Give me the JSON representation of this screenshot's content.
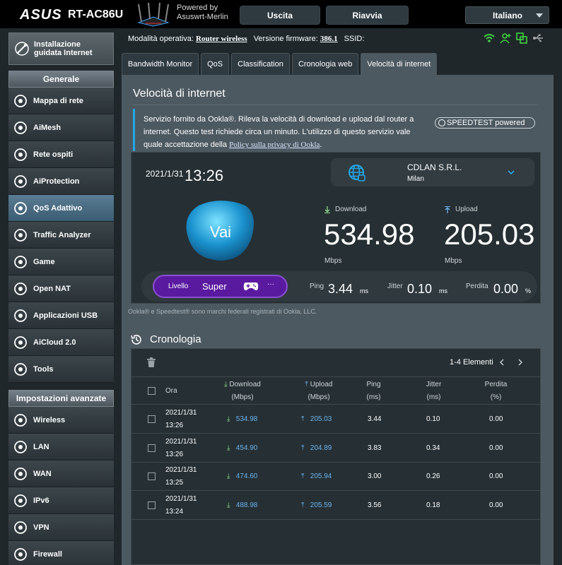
{
  "header": {
    "brand": "ASUS",
    "model": "RT-AC86U",
    "powered_line1": "Powered by",
    "powered_line2": "Asuswrt-Merlin",
    "logout_label": "Uscita",
    "reboot_label": "Riavvia",
    "language": "Italiano"
  },
  "sidebar": {
    "wizard_line1": "Installazione",
    "wizard_line2": "guidata Internet",
    "general_title": "Generale",
    "general_items": [
      {
        "label": "Mappa di rete",
        "icon": "globe-network-icon"
      },
      {
        "label": "AiMesh",
        "icon": "aimesh-icon"
      },
      {
        "label": "Rete ospiti",
        "icon": "guest-network-icon"
      },
      {
        "label": "AiProtection",
        "icon": "shield-lock-icon"
      },
      {
        "label": "QoS Adattivo",
        "icon": "speedometer-icon"
      },
      {
        "label": "Traffic Analyzer",
        "icon": "traffic-icon"
      },
      {
        "label": "Game",
        "icon": "gamepad-icon"
      },
      {
        "label": "Open NAT",
        "icon": "open-nat-icon"
      },
      {
        "label": "Applicazioni USB",
        "icon": "usb-apps-icon"
      },
      {
        "label": "AiCloud 2.0",
        "icon": "cloud-icon"
      },
      {
        "label": "Tools",
        "icon": "wrench-icon"
      }
    ],
    "advanced_title": "Impostazioni avanzate",
    "advanced_items": [
      {
        "label": "Wireless",
        "icon": "wireless-icon"
      },
      {
        "label": "LAN",
        "icon": "lan-icon"
      },
      {
        "label": "WAN",
        "icon": "wan-icon"
      },
      {
        "label": "IPv6",
        "icon": "ipv6-icon"
      },
      {
        "label": "VPN",
        "icon": "vpn-icon"
      },
      {
        "label": "Firewall",
        "icon": "firewall-icon"
      }
    ]
  },
  "status": {
    "mode_label": "Modalità operativa:",
    "mode_value": "Router wireless",
    "firmware_label": "Versione firmware:",
    "firmware_value": "386.1",
    "ssid_label": "SSID:"
  },
  "tabs": [
    {
      "label": "Bandwidth Monitor",
      "active": false
    },
    {
      "label": "QoS",
      "active": false
    },
    {
      "label": "Classification",
      "active": false
    },
    {
      "label": "Cronologia web",
      "active": false
    },
    {
      "label": "Velocità di internet",
      "active": true
    }
  ],
  "speedtest": {
    "title": "Velocità di internet",
    "info_text": "Servizio fornito da Ookla®. Rileva la velocità di download e upload dal router a internet. Questo test richiede circa un minuto. L'utilizzo di questo servizio vale quale accettazione della ",
    "policy_link": "Policy sulla privacy di Ookla",
    "info_end": ".",
    "badge": "SPEEDTEST powered",
    "date": "2021/1/31",
    "time": "13:26",
    "server_name": "CDLAN S.R.L.",
    "server_city": "Milan",
    "go_label": "Vai",
    "download_label": "Download",
    "download_value": "534.98",
    "download_unit": "Mbps",
    "upload_label": "Upload",
    "upload_value": "205.03",
    "upload_unit": "Mbps",
    "level_label": "Livello",
    "level_value": "Super",
    "level_more": "···",
    "ping_label": "Ping",
    "ping_value": "3.44",
    "ping_unit": "ms",
    "jitter_label": "Jitter",
    "jitter_value": "0.10",
    "jitter_unit": "ms",
    "loss_label": "Perdita",
    "loss_value": "0.00",
    "loss_unit": "%",
    "trademark": "Ookla® e Speedtest® sono marchi federali registrati di Ookla, LLC."
  },
  "history": {
    "title": "Cronologia",
    "counter": "1-4 Elementi",
    "headers": {
      "time": "Ora",
      "download": "Download",
      "download_unit": "(Mbps)",
      "upload": "Upload",
      "upload_unit": "(Mbps)",
      "ping": "Ping",
      "ping_unit": "(ms)",
      "jitter": "Jitter",
      "jitter_unit": "(ms)",
      "loss": "Perdita",
      "loss_unit": "(%)"
    },
    "rows": [
      {
        "date": "2021/1/31",
        "time": "13:26",
        "download": "534.98",
        "upload": "205.03",
        "ping": "3.44",
        "jitter": "0.10",
        "loss": "0.00"
      },
      {
        "date": "2021/1/31",
        "time": "13:26",
        "download": "454.90",
        "upload": "204.89",
        "ping": "3.83",
        "jitter": "0.34",
        "loss": "0.00"
      },
      {
        "date": "2021/1/31",
        "time": "13:25",
        "download": "474.60",
        "upload": "205.94",
        "ping": "3.00",
        "jitter": "0.26",
        "loss": "0.00"
      },
      {
        "date": "2021/1/31",
        "time": "13:24",
        "download": "488.98",
        "upload": "205.59",
        "ping": "3.56",
        "jitter": "0.18",
        "loss": "0.00"
      }
    ]
  },
  "colors": {
    "accent_blue": "#23a7e8",
    "level_purple": "#5a1aa0",
    "status_green": "#3fd43f"
  }
}
